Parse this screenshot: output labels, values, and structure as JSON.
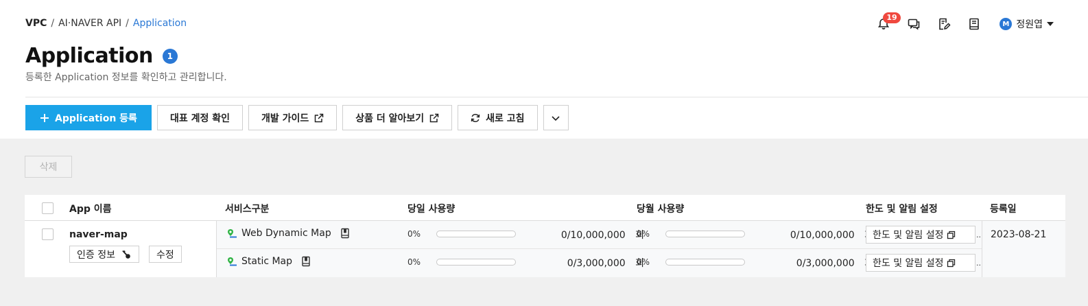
{
  "breadcrumb": {
    "root": "VPC",
    "mid": "AI·NAVER API",
    "current": "Application",
    "sep": "/"
  },
  "topbar": {
    "notification_count": "19",
    "user": {
      "avatar_letter": "M",
      "name": "정원엽"
    }
  },
  "page": {
    "title": "Application",
    "count": "1",
    "subtitle": "등록한 Application 정보를 확인하고 관리합니다."
  },
  "actions": {
    "register": "Application 등록",
    "check_account": "대표 계정 확인",
    "dev_guide": "개발 가이드",
    "learn_more": "상품 더 알아보기",
    "refresh": "새로 고침"
  },
  "delete_button": "삭제",
  "table": {
    "headers": {
      "app_name": "App 이름",
      "service_type": "서비스구분",
      "daily_usage": "당일 사용량",
      "monthly_usage": "당월 사용량",
      "limit_settings": "한도 및 알림 설정",
      "registered": "등록일"
    },
    "rows": [
      {
        "app_name": "naver-map",
        "auth_button": "인증 정보",
        "edit_button": "수정",
        "registered": "2023-08-21",
        "services": [
          {
            "name": "Web Dynamic Map",
            "daily_pct": "0%",
            "daily_fill": 0,
            "daily_usage": "0/10,000,000",
            "unit": "회",
            "monthly_pct": "0%",
            "monthly_fill": 0,
            "monthly_usage": "0/10,000,000",
            "limit_button": "한도 및 알림 설정"
          },
          {
            "name": "Static Map",
            "daily_pct": "0%",
            "daily_fill": 0,
            "daily_usage": "0/3,000,000",
            "unit": "회",
            "monthly_pct": "0%",
            "monthly_fill": 0,
            "monthly_usage": "0/3,000,000",
            "limit_button": "한도 및 알림 설정"
          }
        ]
      }
    ]
  },
  "colors": {
    "primary": "#1aa3e8",
    "link": "#2a78d5",
    "badge": "#f0483e"
  }
}
